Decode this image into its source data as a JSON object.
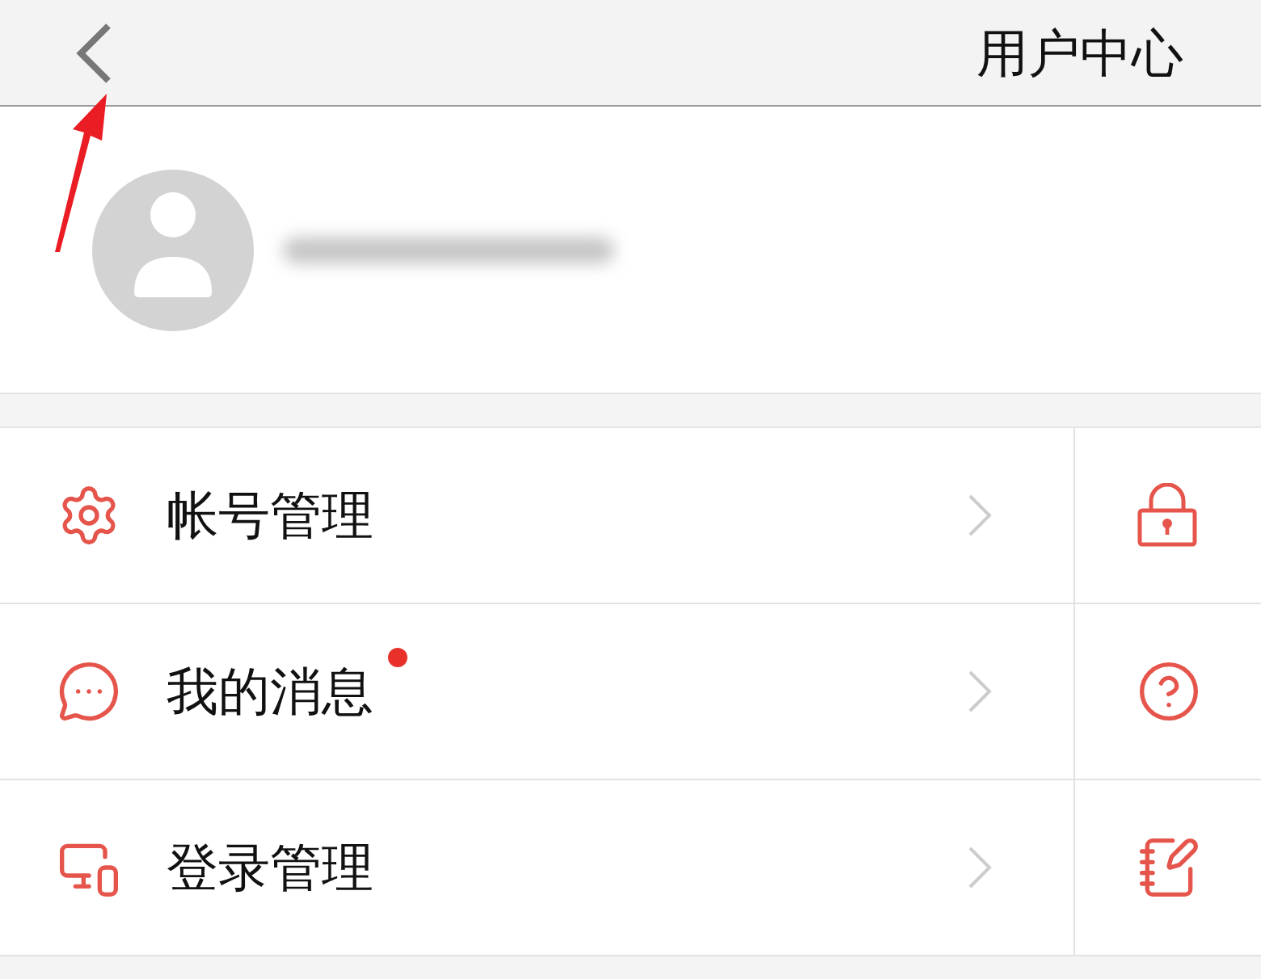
{
  "header": {
    "title": "用户中心"
  },
  "menu": [
    {
      "label": "帐号管理",
      "unread": false
    },
    {
      "label": "我的消息",
      "unread": true
    },
    {
      "label": "登录管理",
      "unread": false
    }
  ]
}
